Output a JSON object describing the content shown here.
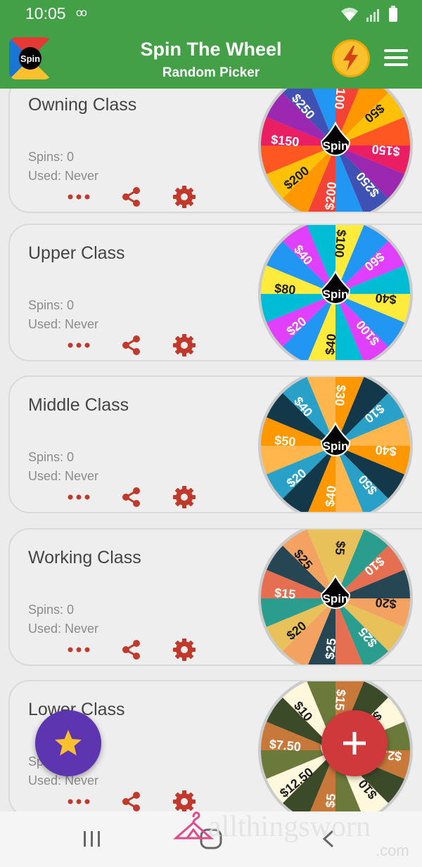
{
  "status_bar": {
    "time": "10:05",
    "voicemail": "oo"
  },
  "app_bar": {
    "title": "Spin The Wheel",
    "subtitle": "Random Picker",
    "logo_text": "Spin",
    "accent": "#43a047"
  },
  "wheels": [
    {
      "name": "Owning Class",
      "spins": "Spins: 0",
      "used": "Used: Never",
      "colors": [
        "#f44336",
        "#ff9800",
        "#ffc107",
        "#ff5722",
        "#e91e63",
        "#9c27b0",
        "#3f51b5",
        "#2196f3",
        "#f44336",
        "#ff9800",
        "#ffc107",
        "#ff5722",
        "#e91e63",
        "#9c27b0",
        "#3f51b5",
        "#2196f3"
      ],
      "labels": [
        "$200",
        "$150",
        "$250",
        "$100",
        "$50",
        "$150",
        "$250",
        "$200"
      ]
    },
    {
      "name": "Upper Class",
      "spins": "Spins: 0",
      "used": "Used: Never",
      "colors": [
        "#ffeb3b",
        "#2196f3",
        "#e040fb",
        "#00bcd4",
        "#ffeb3b",
        "#2196f3",
        "#e040fb",
        "#00bcd4",
        "#ffeb3b",
        "#2196f3",
        "#e040fb",
        "#00bcd4",
        "#ffeb3b",
        "#2196f3",
        "#e040fb",
        "#00bcd4"
      ],
      "labels": [
        "$20",
        "$80",
        "$40",
        "$100",
        "$60",
        "$40",
        "$100",
        "$40"
      ]
    },
    {
      "name": "Middle Class",
      "spins": "Spins: 0",
      "used": "Used: Never",
      "colors": [
        "#ff9800",
        "#12384a",
        "#29a0c8",
        "#ffb74d",
        "#ff9800",
        "#12384a",
        "#29a0c8",
        "#ffb74d",
        "#ff9800",
        "#12384a",
        "#29a0c8",
        "#ffb74d",
        "#ff9800",
        "#12384a",
        "#29a0c8",
        "#ffb74d"
      ],
      "labels": [
        "$20",
        "$50",
        "$40",
        "$30",
        "$10",
        "$40",
        "$50",
        "$40"
      ]
    },
    {
      "name": "Working Class",
      "spins": "Spins: 0",
      "used": "Used: Never",
      "colors": [
        "#e8c15a",
        "#2a9d8f",
        "#e76f51",
        "#264653",
        "#f4a261",
        "#e8c15a",
        "#2a9d8f",
        "#e76f51",
        "#264653",
        "#f4a261",
        "#e8c15a",
        "#2a9d8f",
        "#e76f51",
        "#264653",
        "#f4a261",
        "#e8c15a"
      ],
      "labels": [
        "$20",
        "$15",
        "$25",
        "$5",
        "$10",
        "$20",
        "$25",
        "$25"
      ]
    },
    {
      "name": "Lower Class",
      "spins": "Spins: 0",
      "used": "Used: Never",
      "colors": [
        "#c8793a",
        "#3b4b2a",
        "#fff8dc",
        "#6b7a3a",
        "#c8793a",
        "#3b4b2a",
        "#fff8dc",
        "#6b7a3a",
        "#c8793a",
        "#3b4b2a",
        "#fff8dc",
        "#6b7a3a",
        "#c8793a",
        "#3b4b2a",
        "#fff8dc",
        "#6b7a3a"
      ],
      "labels": [
        "$12.50",
        "$7.50",
        "$10",
        "$15",
        "$5",
        "$2.50",
        "$10",
        "$5"
      ]
    }
  ],
  "wheel_center_label": "Spin",
  "watermark": {
    "text": "allthingsworn",
    "suffix": ".com"
  }
}
